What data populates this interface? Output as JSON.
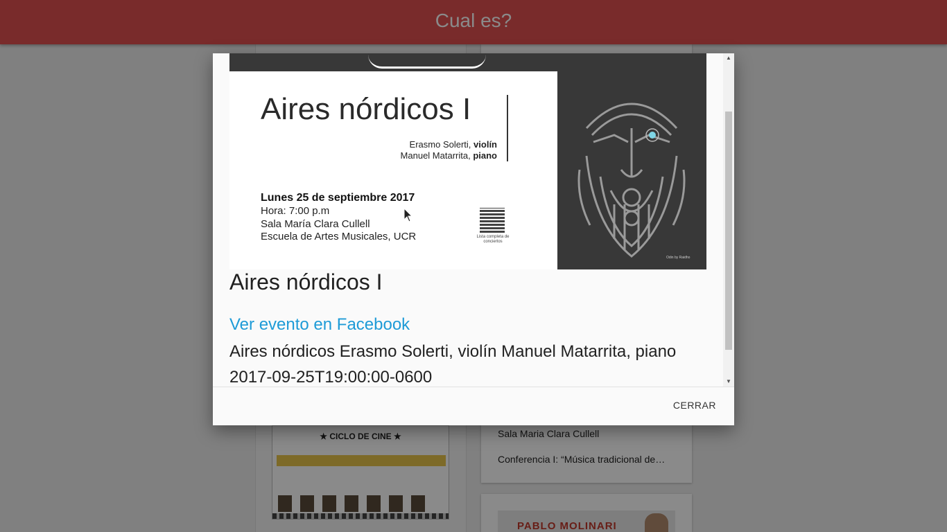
{
  "app": {
    "title": "Cual es?"
  },
  "background": {
    "cards": [
      {
        "line1": "Sala Maria Clara Cullell",
        "line2": "Conferencia I: “Música tradicional de…"
      }
    ],
    "poster_ciclo": {
      "header": "★ CICLO DE CINE ★"
    },
    "poster_comedy": {
      "text": "PABLO MOLINARI"
    }
  },
  "modal": {
    "poster": {
      "title": "Aires nórdicos I",
      "performer1_name": "Erasmo Solerti,",
      "performer1_role": "violín",
      "performer2_name": "Manuel Matarrita,",
      "performer2_role": "piano",
      "date": "Lunes 25 de septiembre 2017",
      "time": "Hora: 7:00 p.m",
      "venue": "Sala María Clara Cullell",
      "school": "Escuela de Artes Musicales, UCR",
      "qr_caption": "Lista completa de conciertos",
      "credit": "Odin by Raidho"
    },
    "event_title": "Aires nórdicos I",
    "facebook_link": "Ver evento en Facebook",
    "description": "Aires nórdicos Erasmo Solerti, violín Manuel Matarrita, piano",
    "datetime": "2017-09-25T19:00:00-0600",
    "close_label": "CERRAR"
  },
  "colors": {
    "topbar": "#e05050",
    "link": "#1e9bd7"
  },
  "icons": {
    "scroll_up": "triangle-up",
    "scroll_down": "triangle-down",
    "cursor": "mouse-pointer"
  }
}
